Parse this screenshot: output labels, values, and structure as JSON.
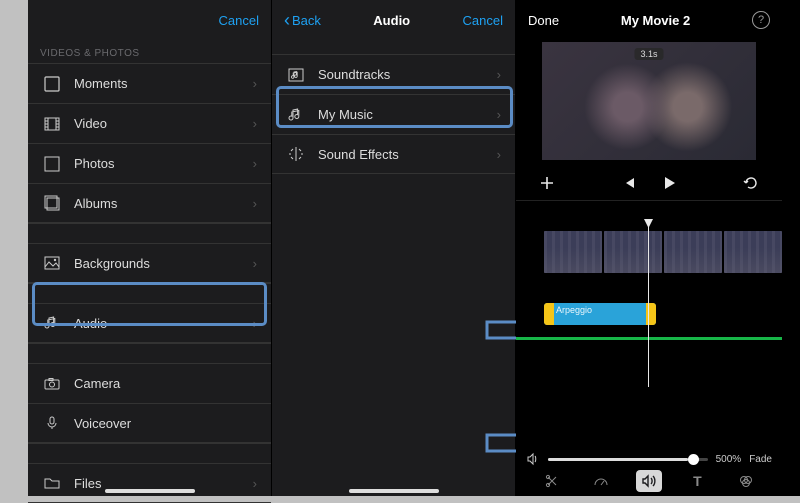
{
  "colors": {
    "link": "#1ea1f2",
    "highlight": "#5b8cc5",
    "audioClip": "#2aa3d9",
    "clipHandle": "#f5c518",
    "greenTrack": "#17b648"
  },
  "pane1": {
    "cancel": "Cancel",
    "section_label": "VIDEOS & PHOTOS",
    "items": [
      {
        "label": "Moments",
        "icon": "moments"
      },
      {
        "label": "Video",
        "icon": "video"
      },
      {
        "label": "Photos",
        "icon": "photos"
      },
      {
        "label": "Albums",
        "icon": "albums"
      }
    ],
    "items_b": [
      {
        "label": "Backgrounds",
        "icon": "backgrounds"
      }
    ],
    "items_c": [
      {
        "label": "Audio",
        "icon": "audio"
      }
    ],
    "items_d": [
      {
        "label": "Camera",
        "icon": "camera"
      },
      {
        "label": "Voiceover",
        "icon": "voiceover"
      }
    ],
    "items_e": [
      {
        "label": "Files",
        "icon": "files"
      }
    ]
  },
  "pane2": {
    "back": "Back",
    "title": "Audio",
    "cancel": "Cancel",
    "items": [
      {
        "label": "Soundtracks",
        "icon": "soundtracks"
      },
      {
        "label": "My Music",
        "icon": "mymusic"
      },
      {
        "label": "Sound Effects",
        "icon": "soundfx"
      }
    ]
  },
  "pane3": {
    "done": "Done",
    "title": "My Movie 2",
    "preview_time": "3.1s",
    "clip_label": "Arpeggio",
    "volume_pct": "500%",
    "fade_label": "Fade"
  }
}
